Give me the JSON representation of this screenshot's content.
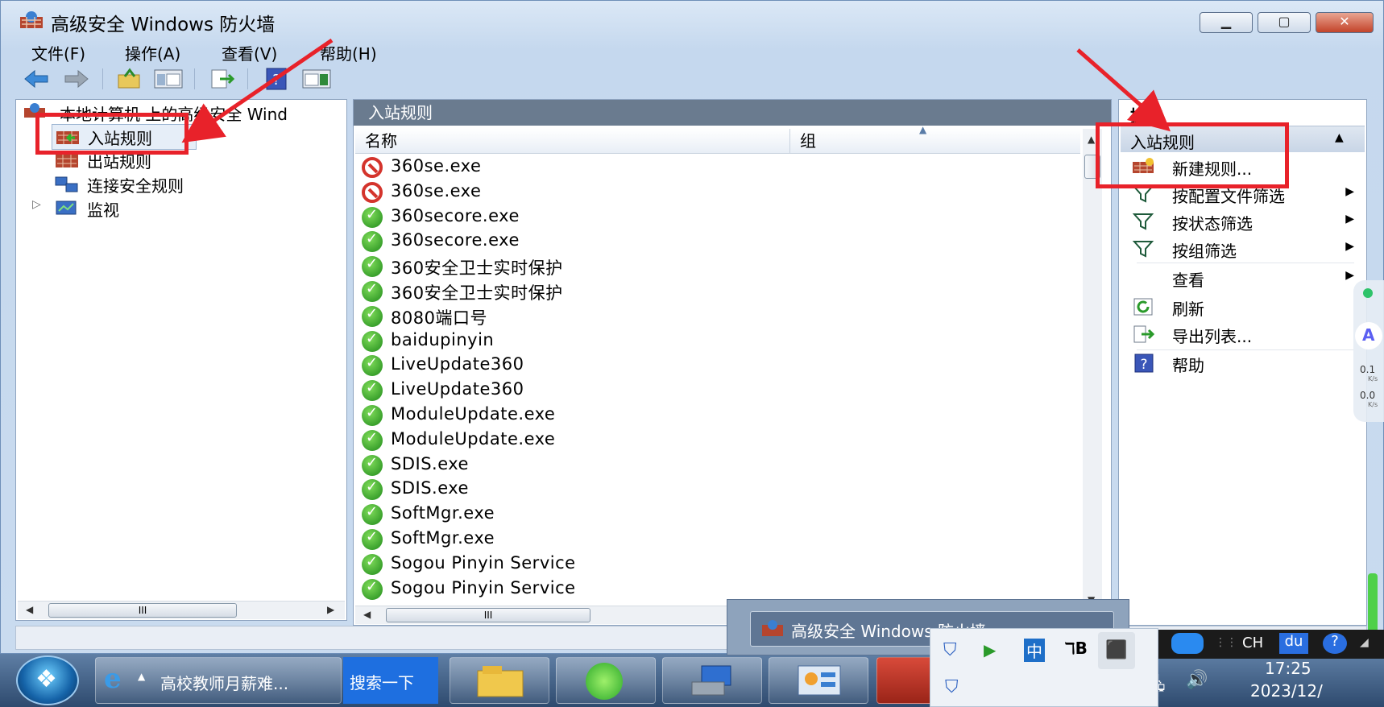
{
  "window": {
    "title": "高级安全 Windows 防火墙"
  },
  "menu": [
    "文件(F)",
    "操作(A)",
    "查看(V)",
    "帮助(H)"
  ],
  "tree": {
    "root": "本地计算机 上的高级安全 Wind",
    "items": [
      "入站规则",
      "出站规则",
      "连接安全规则",
      "监视"
    ]
  },
  "middle": {
    "header": "入站规则",
    "columns": [
      "名称",
      "组"
    ],
    "rows": [
      {
        "name": "360se.exe",
        "status": "block"
      },
      {
        "name": "360se.exe",
        "status": "block"
      },
      {
        "name": "360secore.exe",
        "status": "allow"
      },
      {
        "name": "360secore.exe",
        "status": "allow"
      },
      {
        "name": "360安全卫士实时保护",
        "status": "allow"
      },
      {
        "name": "360安全卫士实时保护",
        "status": "allow"
      },
      {
        "name": "8080端口号",
        "status": "allow"
      },
      {
        "name": "baidupinyin",
        "status": "allow"
      },
      {
        "name": "LiveUpdate360",
        "status": "allow"
      },
      {
        "name": "LiveUpdate360",
        "status": "allow"
      },
      {
        "name": "ModuleUpdate.exe",
        "status": "allow"
      },
      {
        "name": "ModuleUpdate.exe",
        "status": "allow"
      },
      {
        "name": "SDIS.exe",
        "status": "allow"
      },
      {
        "name": "SDIS.exe",
        "status": "allow"
      },
      {
        "name": "SoftMgr.exe",
        "status": "allow"
      },
      {
        "name": "SoftMgr.exe",
        "status": "allow"
      },
      {
        "name": "Sogou Pinyin Service",
        "status": "allow"
      },
      {
        "name": "Sogou Pinyin Service",
        "status": "allow"
      }
    ]
  },
  "actions": {
    "header": "操作",
    "section": "入站规则",
    "items": [
      "新建规则...",
      "按配置文件筛选",
      "按状态筛选",
      "按组筛选",
      "查看",
      "刷新",
      "导出列表...",
      "帮助"
    ]
  },
  "taskbar": {
    "ie_title": "高校教师月薪难...",
    "search_btn": "搜索一下",
    "preview_title": "高级安全 Windows 防火墙",
    "ime_lang": "CH",
    "ime_label": "du",
    "ime_cn": "中",
    "time": "17:25",
    "date": "2023/12/",
    "speed_up": "0.1",
    "speed_down": "0.0",
    "speed_unit": "K/s"
  },
  "colors": {
    "annotation": "#e8222a",
    "pane_header": "#6a7b8f"
  }
}
